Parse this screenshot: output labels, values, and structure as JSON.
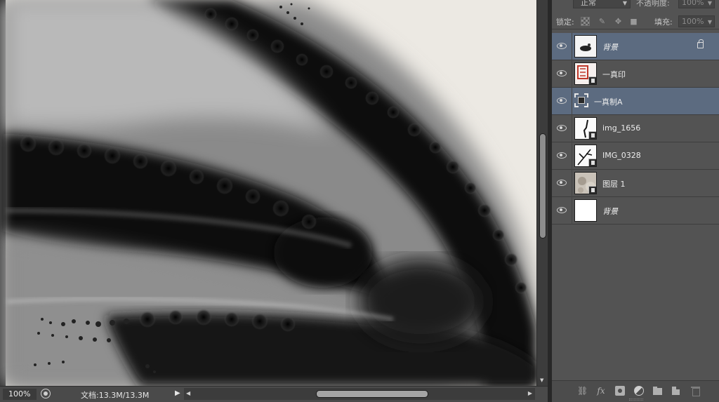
{
  "colors": {
    "panel_bg": "#535353",
    "selected_row": "#5c6b80",
    "canvas_paper": "#efece6",
    "ink": "#111111"
  },
  "status_bar": {
    "zoom": "100%",
    "doc_info": "文档:13.3M/13.3M"
  },
  "layers_panel": {
    "blend_mode": "正常",
    "opacity_label": "不透明度:",
    "opacity_value": "100%",
    "lock_label": "锁定:",
    "fill_label": "填充:",
    "fill_value": "100%",
    "layers": [
      {
        "name": "背景",
        "italic": true,
        "selected": true,
        "locked": true,
        "thumb": "ink-fish-thumbnail",
        "smart_object": false
      },
      {
        "name": "一真印",
        "italic": false,
        "selected": false,
        "locked": false,
        "thumb": "red-seal-thumbnail",
        "smart_object": true
      },
      {
        "name": "一真制A",
        "italic": false,
        "selected": true,
        "locked": false,
        "thumb": "frame-thumbnail",
        "smart_object": true
      },
      {
        "name": "img_1656",
        "italic": false,
        "selected": false,
        "locked": false,
        "thumb": "ink-stroke-thumbnail",
        "smart_object": true
      },
      {
        "name": "IMG_0328",
        "italic": false,
        "selected": false,
        "locked": false,
        "thumb": "ink-branch-thumbnail",
        "smart_object": true
      },
      {
        "name": "图层 1",
        "italic": false,
        "selected": false,
        "locked": false,
        "thumb": "paper-texture-thumbnail",
        "smart_object": true
      },
      {
        "name": "背景",
        "italic": true,
        "selected": false,
        "locked": false,
        "thumb": "white-thumbnail",
        "smart_object": false
      }
    ],
    "bottom_icons": [
      "link-icon",
      "fx-icon",
      "mask-icon",
      "adjustment-icon",
      "folder-icon",
      "new-layer-icon",
      "trash-icon"
    ]
  }
}
